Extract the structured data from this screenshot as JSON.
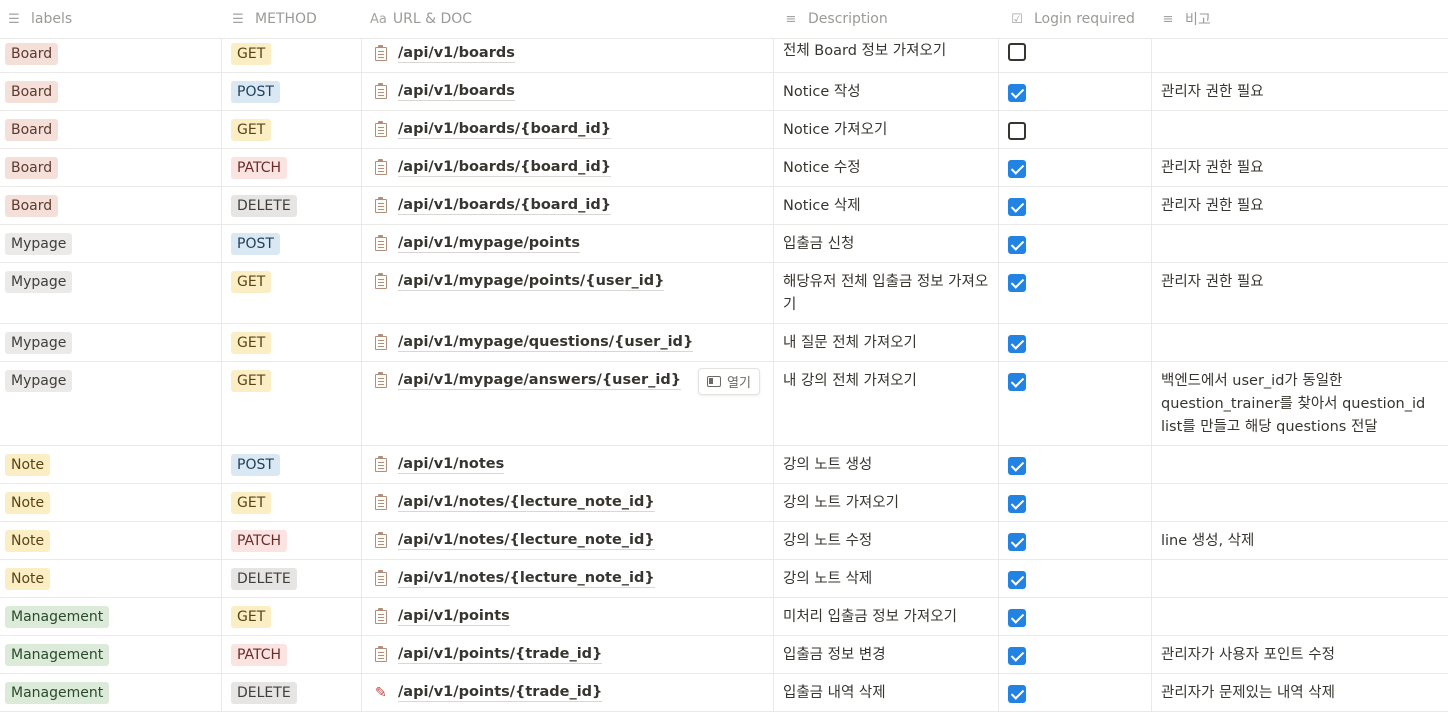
{
  "header": {
    "labels": "labels",
    "method": "METHOD",
    "url_doc": "URL & DOC",
    "url_prefix": "Aa",
    "description": "Description",
    "login_required": "Login required",
    "note": "비고"
  },
  "icons": {
    "list": "list-icon",
    "text_type": "text-type-icon",
    "checkbox": "checkbox-icon",
    "page": "clipboard-doc-icon",
    "pen": "pen-icon"
  },
  "open_button": {
    "label": "열기"
  },
  "rows": [
    {
      "label": "Board",
      "method": "GET",
      "url": "/api/v1/boards",
      "description": "전체 Board 정보 가져오기",
      "login": false,
      "note": ""
    },
    {
      "label": "Board",
      "method": "POST",
      "url": "/api/v1/boards",
      "description": "Notice 작성",
      "login": true,
      "note": "관리자 권한 필요"
    },
    {
      "label": "Board",
      "method": "GET",
      "url": "/api/v1/boards/{board_id}",
      "description": "Notice 가져오기",
      "login": false,
      "note": ""
    },
    {
      "label": "Board",
      "method": "PATCH",
      "url": "/api/v1/boards/{board_id}",
      "description": "Notice 수정",
      "login": true,
      "note": "관리자 권한 필요"
    },
    {
      "label": "Board",
      "method": "DELETE",
      "url": "/api/v1/boards/{board_id}",
      "description": "Notice 삭제",
      "login": true,
      "note": "관리자 권한 필요"
    },
    {
      "label": "Mypage",
      "method": "POST",
      "url": "/api/v1/mypage/points",
      "description": "입출금 신청",
      "login": true,
      "note": ""
    },
    {
      "label": "Mypage",
      "method": "GET",
      "url": "/api/v1/mypage/points/{user_id}",
      "description": "해당유저 전체 입출금 정보 가져오기",
      "login": true,
      "note": "관리자 권한 필요"
    },
    {
      "label": "Mypage",
      "method": "GET",
      "url": "/api/v1/mypage/questions/{user_id}",
      "description": "내 질문 전체 가져오기",
      "login": true,
      "note": ""
    },
    {
      "label": "Mypage",
      "method": "GET",
      "url": "/api/v1/mypage/answers/{user_id}",
      "description": "내 강의 전체 가져오기",
      "login": true,
      "note": "백엔드에서 user_id가 동일한 question_trainer를 찾아서 question_id list를 만들고 해당 questions 전달"
    },
    {
      "label": "Note",
      "method": "POST",
      "url": "/api/v1/notes",
      "description": "강의 노트 생성",
      "login": true,
      "note": ""
    },
    {
      "label": "Note",
      "method": "GET",
      "url": "/api/v1/notes/{lecture_note_id}",
      "description": "강의 노트 가져오기",
      "login": true,
      "note": ""
    },
    {
      "label": "Note",
      "method": "PATCH",
      "url": "/api/v1/notes/{lecture_note_id}",
      "description": "강의 노트 수정",
      "login": true,
      "note": "line 생성, 삭제"
    },
    {
      "label": "Note",
      "method": "DELETE",
      "url": "/api/v1/notes/{lecture_note_id}",
      "description": "강의 노트 삭제",
      "login": true,
      "note": ""
    },
    {
      "label": "Management",
      "method": "GET",
      "url": "/api/v1/points",
      "description": "미처리 입출금 정보 가져오기",
      "login": true,
      "note": ""
    },
    {
      "label": "Management",
      "method": "PATCH",
      "url": "/api/v1/points/{trade_id}",
      "description": "입출금 정보 변경",
      "login": true,
      "note": "관리자가 사용자 포인트 수정"
    },
    {
      "label": "Management",
      "method": "DELETE",
      "url": "/api/v1/points/{trade_id}",
      "description": "입출금 내역 삭제",
      "login": true,
      "note": "관리자가 문제있는 내역 삭제"
    }
  ]
}
